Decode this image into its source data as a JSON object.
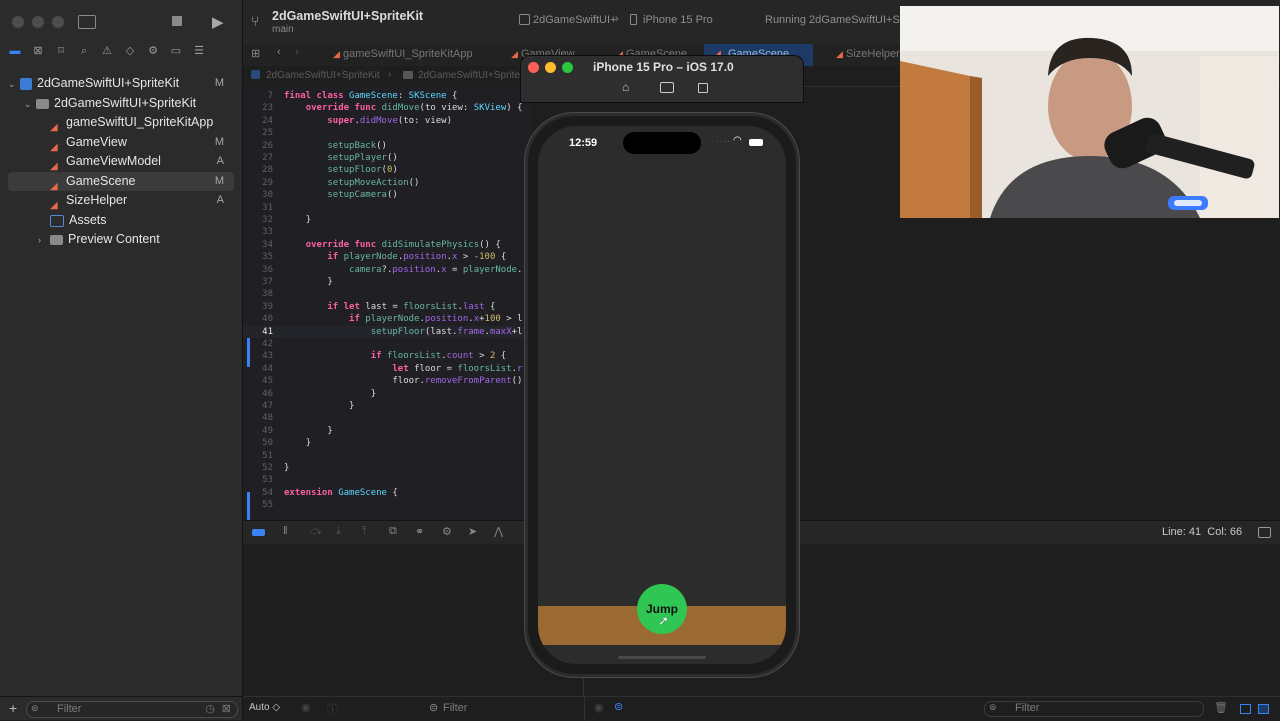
{
  "toolbar": {
    "project_title": "2dGameSwiftUI+SpriteKit",
    "branch": "main",
    "scheme": "2dGameSwiftUI+",
    "device": "iPhone 15 Pro",
    "status": "Running 2dGameSwiftUI+Sprit"
  },
  "tabs": [
    {
      "label": "gameSwiftUI_SpriteKitApp"
    },
    {
      "label": "GameView"
    },
    {
      "label": "GameScene"
    },
    {
      "label": "GameScene"
    },
    {
      "label": "SizeHelper"
    }
  ],
  "jumpbar": [
    "2dGameSwiftUI+SpriteKit",
    "2dGameSwiftUI+SpriteKit"
  ],
  "navigator": {
    "items": [
      {
        "label": "2dGameSwiftUI+SpriteKit",
        "badge": "M",
        "kind": "project"
      },
      {
        "label": "2dGameSwiftUI+SpriteKit",
        "badge": "",
        "kind": "folder"
      },
      {
        "label": "gameSwiftUI_SpriteKitApp",
        "badge": "",
        "kind": "swift"
      },
      {
        "label": "GameView",
        "badge": "M",
        "kind": "swift"
      },
      {
        "label": "GameViewModel",
        "badge": "A",
        "kind": "swift"
      },
      {
        "label": "GameScene",
        "badge": "M",
        "kind": "swift"
      },
      {
        "label": "SizeHelper",
        "badge": "A",
        "kind": "swift"
      },
      {
        "label": "Assets",
        "badge": "",
        "kind": "assets"
      },
      {
        "label": "Preview Content",
        "badge": "",
        "kind": "folder"
      }
    ],
    "filter_placeholder": "Filter"
  },
  "editor": {
    "lines": [
      {
        "n": "7",
        "text": "final class GameScene: SKScene {"
      },
      {
        "n": "23",
        "text": "    override func didMove(to view: SKView) {"
      },
      {
        "n": "24",
        "text": "        super.didMove(to: view)"
      },
      {
        "n": "25",
        "text": ""
      },
      {
        "n": "26",
        "text": "        setupBack()"
      },
      {
        "n": "27",
        "text": "        setupPlayer()"
      },
      {
        "n": "28",
        "text": "        setupFloor(0)"
      },
      {
        "n": "29",
        "text": "        setupMoveAction()"
      },
      {
        "n": "30",
        "text": "        setupCamera()"
      },
      {
        "n": "31",
        "text": ""
      },
      {
        "n": "32",
        "text": "    }"
      },
      {
        "n": "33",
        "text": ""
      },
      {
        "n": "34",
        "text": "    override func didSimulatePhysics() {"
      },
      {
        "n": "35",
        "text": "        if playerNode.position.x > -100 {"
      },
      {
        "n": "36",
        "text": "            camera?.position.x = playerNode."
      },
      {
        "n": "37",
        "text": "        }"
      },
      {
        "n": "38",
        "text": ""
      },
      {
        "n": "39",
        "text": "        if let last = floorsList.last {"
      },
      {
        "n": "40",
        "text": "            if playerNode.position.x+100 > l"
      },
      {
        "n": "41",
        "text": "                setupFloor(last.frame.maxX+l"
      },
      {
        "n": "42",
        "text": ""
      },
      {
        "n": "43",
        "text": "                if floorsList.count > 2 {"
      },
      {
        "n": "44",
        "text": "                    let floor = floorsList.r"
      },
      {
        "n": "45",
        "text": "                    floor.removeFromParent()"
      },
      {
        "n": "46",
        "text": "                }"
      },
      {
        "n": "47",
        "text": "            }"
      },
      {
        "n": "48",
        "text": ""
      },
      {
        "n": "49",
        "text": "        }"
      },
      {
        "n": "50",
        "text": "    }"
      },
      {
        "n": "51",
        "text": ""
      },
      {
        "n": "52",
        "text": "}"
      },
      {
        "n": "53",
        "text": ""
      },
      {
        "n": "54",
        "text": "extension GameScene {"
      },
      {
        "n": "55",
        "text": ""
      }
    ],
    "current_line": "41"
  },
  "debug": {
    "cursor_position": "Line: 41  Col: 66"
  },
  "bottom": {
    "auto_label": "Auto ◇",
    "console_filter": "Filter",
    "right_filter": "Filter"
  },
  "simulator": {
    "title": "iPhone 15 Pro – iOS 17.0",
    "time": "12:59",
    "jump_button": "Jump",
    "colors": {
      "floor": "#9b6a33",
      "button": "#2fc653",
      "background": "#2c2c2c"
    }
  }
}
